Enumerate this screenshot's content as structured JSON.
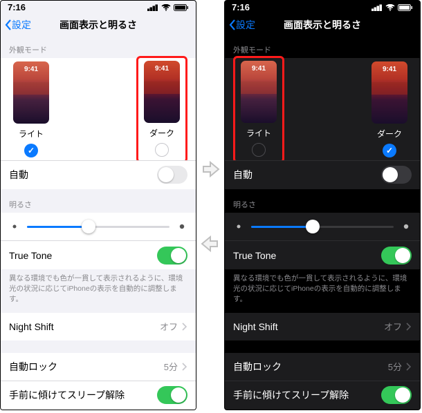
{
  "time": "7:16",
  "nav": {
    "back": "設定",
    "title": "画面表示と明るさ"
  },
  "sections": {
    "appearance": "外観モード",
    "brightness": "明るさ"
  },
  "modes": {
    "light": "ライト",
    "dark": "ダーク",
    "thumb_clock": "9:41"
  },
  "rows": {
    "auto": "自動",
    "truetone": "True Tone",
    "truetone_foot": "異なる環境でも色が一貫して表示されるように、環境光の状況に応じてiPhoneの表示を自動的に調整します。",
    "nightshift": "Night Shift",
    "nightshift_value": "オフ",
    "autolock": "自動ロック",
    "autolock_value": "5分",
    "raise": "手前に傾けてスリープ解除"
  },
  "left": {
    "selected": "light",
    "highlighted": "dark",
    "auto_on": false,
    "truetone_on": true,
    "raise_on": true,
    "brightness_pct": 43
  },
  "right": {
    "selected": "dark",
    "highlighted": "light",
    "auto_on": false,
    "truetone_on": true,
    "raise_on": true,
    "brightness_pct": 43
  }
}
